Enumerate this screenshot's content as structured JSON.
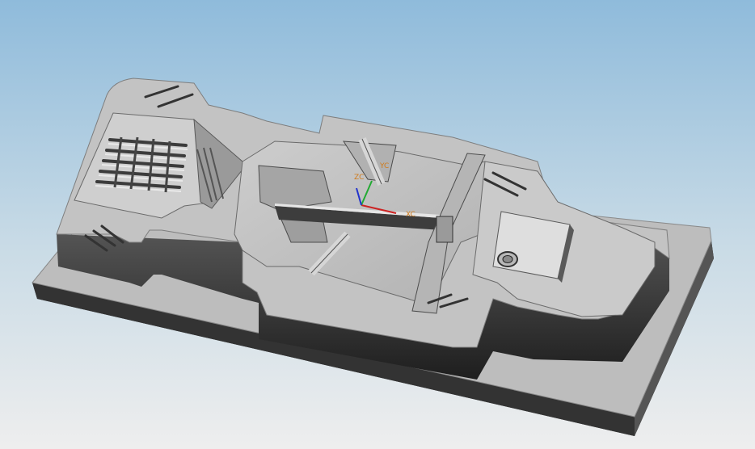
{
  "viewport": {
    "background_top": "#8fbbdb",
    "background_bottom": "#f0f0f0"
  },
  "model": {
    "base_top_color": "#b9b9b9",
    "base_side_color": "#2e2e2e",
    "cavity_floor_color": "#c2c2c2",
    "pocket_wall_color": "#3a3a3a",
    "highlight_color": "#e2e2e2"
  },
  "triad": {
    "x_color": "#cc2222",
    "y_color": "#22aa33",
    "z_color": "#2233cc",
    "x_label": "XC",
    "y_label": "YC",
    "z_label": "ZC",
    "label_color": "#d07a1a"
  }
}
